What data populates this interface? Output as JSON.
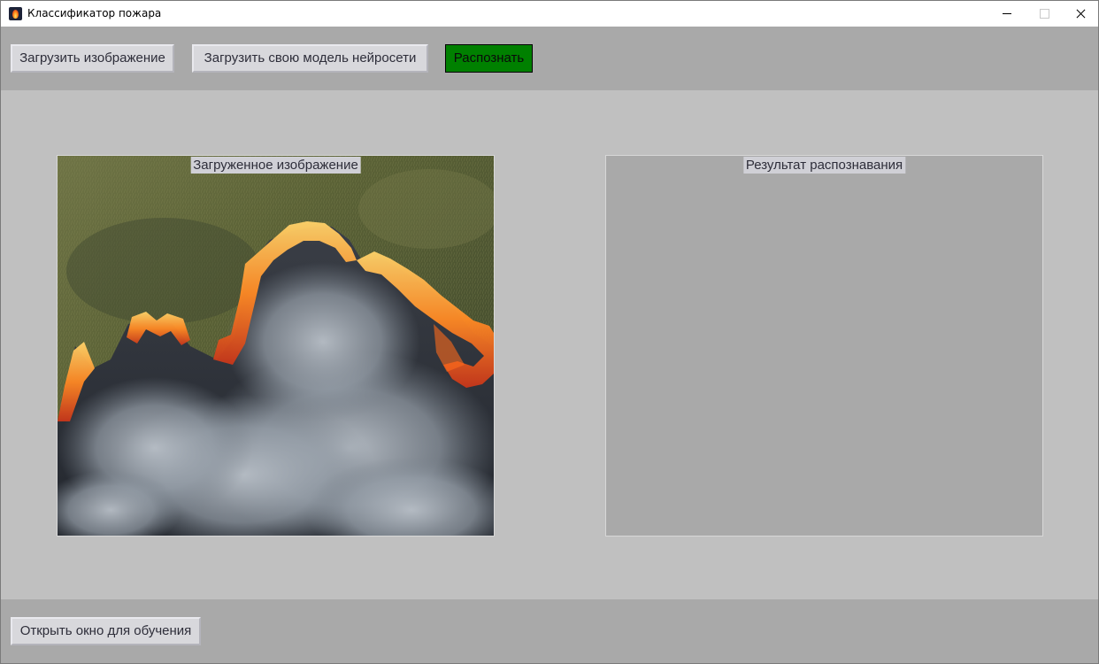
{
  "window": {
    "title": "Классификатор пожара",
    "controls": [
      "minimize-icon",
      "maximize-icon",
      "close-icon"
    ]
  },
  "toolbar": {
    "load_image_label": "Загрузить изображение",
    "load_model_label": "Загрузить свою модель нейросети",
    "recognize_label": "Распознать"
  },
  "panels": {
    "loaded_label": "Загруженное изображение",
    "result_label": "Результат распознавания"
  },
  "bottom": {
    "train_label": "Открыть окно для обучения"
  },
  "colors": {
    "toolbar_bg": "#a9a9a9",
    "main_bg": "#c0c0c0",
    "button_bg": "#d8d8dc",
    "recognize_bg": "#008000",
    "result_panel_bg": "#a9a9a9"
  }
}
